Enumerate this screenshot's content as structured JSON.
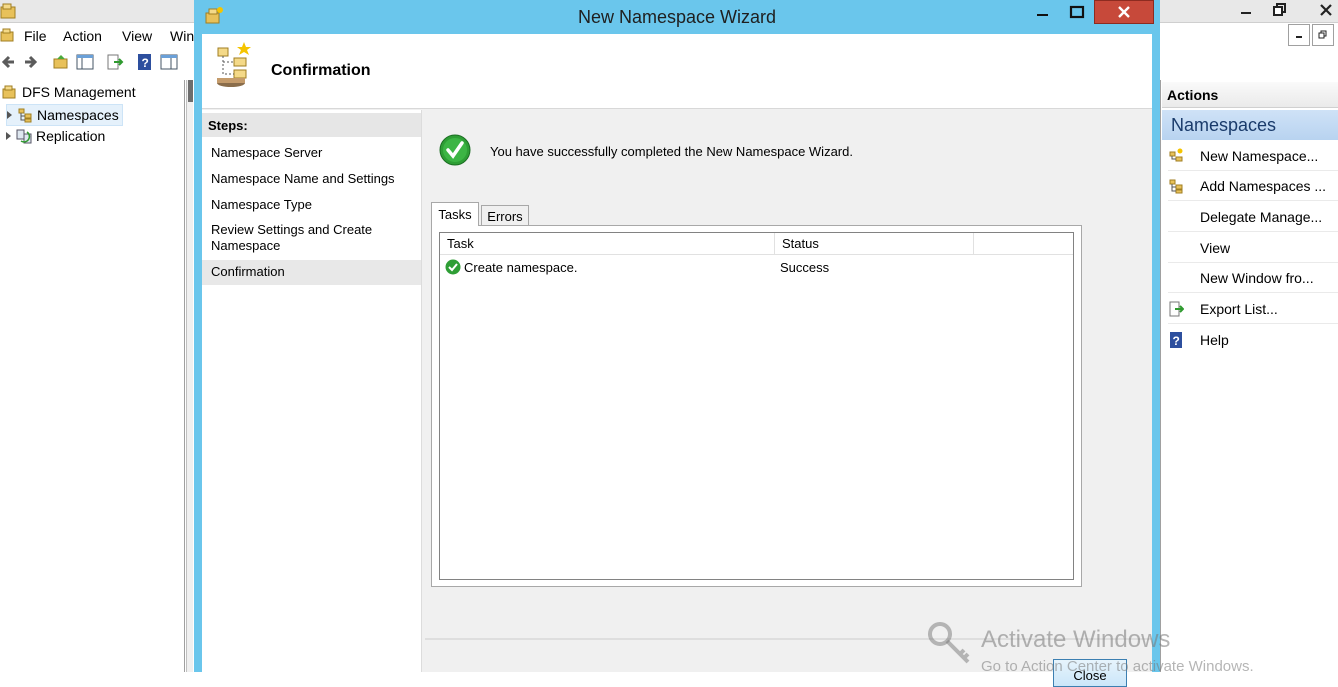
{
  "background_app": {
    "menu": [
      "File",
      "Action",
      "View",
      "Win"
    ],
    "tree": {
      "root": "DFS Management",
      "items": [
        "Namespaces",
        "Replication"
      ]
    },
    "actions": {
      "header": "Actions",
      "section": "Namespaces",
      "items": [
        {
          "label": "New Namespace...",
          "icon": "new-namespace-icon"
        },
        {
          "label": "Add Namespaces ...",
          "icon": "add-namespaces-icon"
        },
        {
          "label": "Delegate Manage...",
          "icon": ""
        },
        {
          "label": "View",
          "icon": ""
        },
        {
          "label": "New Window fro...",
          "icon": ""
        },
        {
          "label": "Export List...",
          "icon": "export-list-icon"
        },
        {
          "label": "Help",
          "icon": "help-icon"
        }
      ]
    }
  },
  "wizard": {
    "title": "New Namespace Wizard",
    "page_title": "Confirmation",
    "steps_label": "Steps:",
    "steps": [
      "Namespace Server",
      "Namespace Name and Settings",
      "Namespace Type",
      "Review Settings and Create Namespace",
      "Confirmation"
    ],
    "active_step": "Confirmation",
    "success_message": "You have successfully completed the New Namespace Wizard.",
    "tabs": [
      "Tasks",
      "Errors"
    ],
    "table": {
      "columns": [
        "Task",
        "Status"
      ],
      "rows": [
        {
          "task": "Create namespace.",
          "status": "Success"
        }
      ]
    },
    "close_label": "Close"
  },
  "watermark": {
    "title": "Activate Windows",
    "subtitle": "Go to Action Center to activate Windows."
  },
  "colors": {
    "wizard_frame": "#6ac6ec",
    "close_button": "#c7493a",
    "actions_section": "#b8d3f0"
  }
}
